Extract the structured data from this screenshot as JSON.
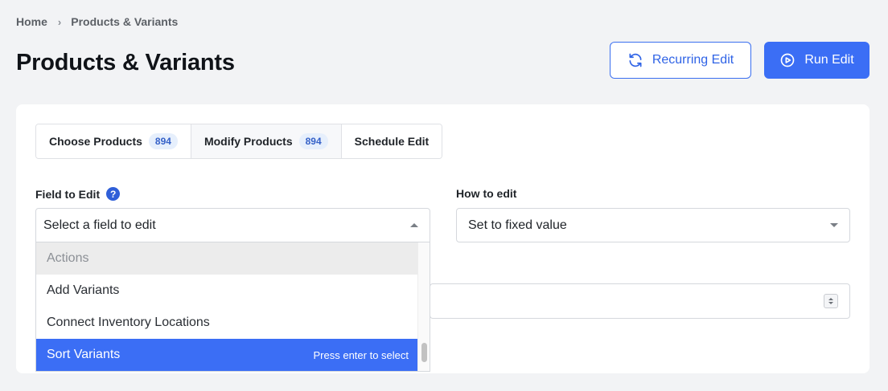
{
  "breadcrumb": {
    "home": "Home",
    "separator": "›",
    "current": "Products & Variants"
  },
  "page": {
    "title": "Products & Variants"
  },
  "actions": {
    "recurring_label": "Recurring Edit",
    "run_label": "Run Edit"
  },
  "tabs": [
    {
      "label": "Choose Products",
      "badge": "894"
    },
    {
      "label": "Modify Products",
      "badge": "894"
    },
    {
      "label": "Schedule Edit"
    }
  ],
  "field_to_edit": {
    "label": "Field to Edit",
    "help_icon": "?",
    "placeholder": "Select a field to edit",
    "dropdown": {
      "group": "Actions",
      "options": [
        "Add Variants",
        "Connect Inventory Locations",
        "Sort Variants"
      ],
      "highlighted": "Sort Variants",
      "hint": "Press enter to select"
    }
  },
  "how_to_edit": {
    "label": "How to edit",
    "value": "Set to fixed value"
  },
  "colors": {
    "accent": "#3b6ef5",
    "badge_bg": "#e6effc",
    "help_icon": "#2f5fd8"
  }
}
